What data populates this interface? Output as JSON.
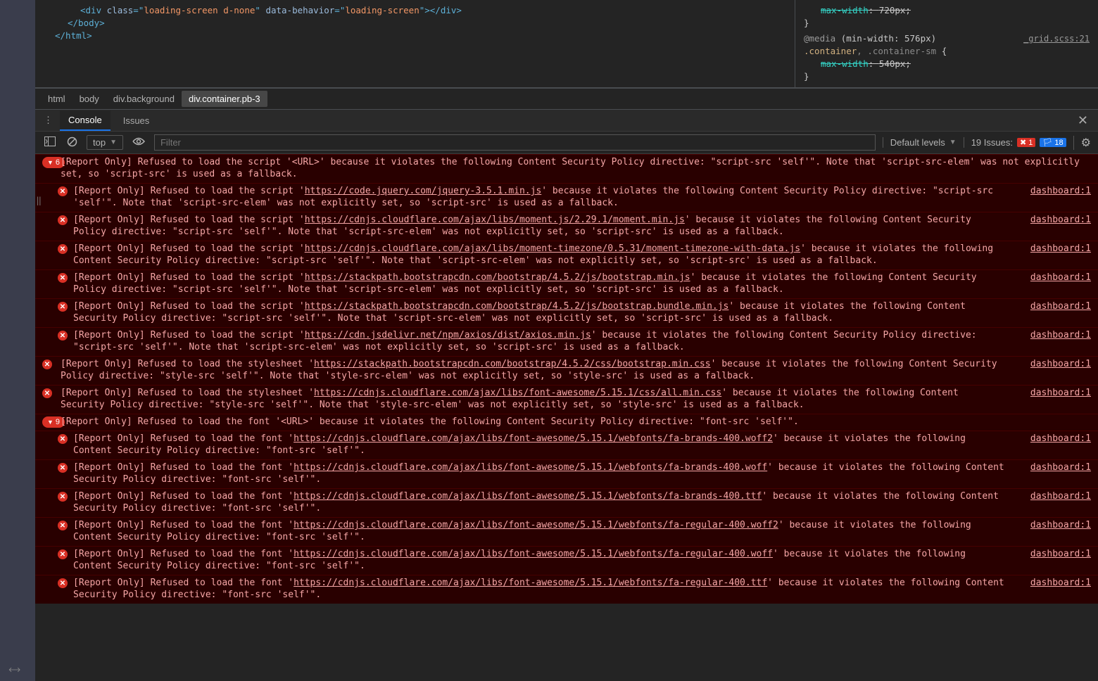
{
  "elements_html": {
    "line1_pre": "<div ",
    "line1_attr1": "class",
    "line1_val1": "loading-screen d-none",
    "line1_attr2": "data-behavior",
    "line1_val2": "loading-screen",
    "line1_post": "></div>",
    "line2": "</body>",
    "line3": "</html>"
  },
  "styles": {
    "rule0_prop": "max-width",
    "rule0_val": "720px;",
    "close0": "}",
    "at": "@media",
    "atcond": "(min-width: 576px)",
    "sel1a": ".container",
    "sel1b": ", .container-sm",
    "brace": "{",
    "prop1": "max-width",
    "val1": "540px;",
    "close1": "}",
    "srclink": "_grid.scss:21"
  },
  "crumbs": {
    "c1": "html",
    "c2": "body",
    "c3": "div.background",
    "c4": "div.container.pb-3"
  },
  "drawer": {
    "tab_console": "Console",
    "tab_issues": "Issues"
  },
  "toolbar": {
    "context": "top",
    "filter_placeholder": "Filter",
    "levels": "Default levels",
    "issues_label": "19 Issues:",
    "issues_red": "1",
    "issues_blue": "18"
  },
  "console": {
    "group1_count": "6",
    "group2_count": "9",
    "msgs": [
      {
        "lvl": 0,
        "group": "6",
        "pre": "[Report Only] Refused to load the script '<URL>' because it violates the following Content Security Policy directive: \"script-src 'self'\". Note that 'script-src-elem' was not explicitly set, so 'script-src' is used as a fallback.",
        "url": "",
        "post": "",
        "src": ""
      },
      {
        "lvl": 1,
        "err": true,
        "pre": "[Report Only] Refused to load the script '",
        "url": "https://code.jquery.com/jquery-3.5.1.min.js",
        "post": "' because it violates the following Content Security Policy directive: \"script-src 'self'\". Note that 'script-src-elem' was not explicitly set, so 'script-src' is used as a fallback.",
        "src": "dashboard:1"
      },
      {
        "lvl": 1,
        "err": true,
        "pre": "[Report Only] Refused to load the script '",
        "url": "https://cdnjs.cloudflare.com/ajax/libs/moment.js/2.29.1/moment.min.js",
        "post": "' because it violates the following Content Security Policy directive: \"script-src 'self'\". Note that 'script-src-elem' was not explicitly set, so 'script-src' is used as a fallback.",
        "src": "dashboard:1"
      },
      {
        "lvl": 1,
        "err": true,
        "pre": "[Report Only] Refused to load the script '",
        "url": "https://cdnjs.cloudflare.com/ajax/libs/moment-timezone/0.5.31/moment-timezone-with-data.js",
        "post": "' because it violates the following Content Security Policy directive: \"script-src 'self'\". Note that 'script-src-elem' was not explicitly set, so 'script-src' is used as a fallback.",
        "src": "dashboard:1"
      },
      {
        "lvl": 1,
        "err": true,
        "pre": "[Report Only] Refused to load the script '",
        "url": "https://stackpath.bootstrapcdn.com/bootstrap/4.5.2/js/bootstrap.min.js",
        "post": "' because it violates the following Content Security Policy directive: \"script-src 'self'\". Note that 'script-src-elem' was not explicitly set, so 'script-src' is used as a fallback.",
        "src": "dashboard:1"
      },
      {
        "lvl": 1,
        "err": true,
        "pre": "[Report Only] Refused to load the script '",
        "url": "https://stackpath.bootstrapcdn.com/bootstrap/4.5.2/js/bootstrap.bundle.min.js",
        "post": "' because it violates the following Content Security Policy directive: \"script-src 'self'\". Note that 'script-src-elem' was not explicitly set, so 'script-src' is used as a fallback.",
        "src": "dashboard:1"
      },
      {
        "lvl": 1,
        "err": true,
        "pre": "[Report Only] Refused to load the script '",
        "url": "https://cdn.jsdelivr.net/npm/axios/dist/axios.min.js",
        "post": "' because it violates the following Content Security Policy directive: \"script-src 'self'\". Note that 'script-src-elem' was not explicitly set, so 'script-src' is used as a fallback.",
        "src": "dashboard:1"
      },
      {
        "lvl": 0,
        "err": true,
        "pre": "[Report Only] Refused to load the stylesheet '",
        "url": "https://stackpath.bootstrapcdn.com/bootstrap/4.5.2/css/bootstrap.min.css",
        "post": "' because it violates the following Content Security Policy directive: \"style-src 'self'\". Note that 'style-src-elem' was not explicitly set, so 'style-src' is used as a fallback.",
        "src": "dashboard:1"
      },
      {
        "lvl": 0,
        "err": true,
        "pre": "[Report Only] Refused to load the stylesheet '",
        "url": "https://cdnjs.cloudflare.com/ajax/libs/font-awesome/5.15.1/css/all.min.css",
        "post": "' because it violates the following Content Security Policy directive: \"style-src 'self'\". Note that 'style-src-elem' was not explicitly set, so 'style-src' is used as a fallback.",
        "src": "dashboard:1"
      },
      {
        "lvl": 0,
        "group": "9",
        "pre": "[Report Only] Refused to load the font '<URL>' because it violates the following Content Security Policy directive: \"font-src 'self'\".",
        "url": "",
        "post": "",
        "src": ""
      },
      {
        "lvl": 1,
        "err": true,
        "pre": "[Report Only] Refused to load the font '",
        "url": "https://cdnjs.cloudflare.com/ajax/libs/font-awesome/5.15.1/webfonts/fa-brands-400.woff2",
        "post": "' because it violates the following Content Security Policy directive: \"font-src 'self'\".",
        "src": "dashboard:1"
      },
      {
        "lvl": 1,
        "err": true,
        "pre": "[Report Only] Refused to load the font '",
        "url": "https://cdnjs.cloudflare.com/ajax/libs/font-awesome/5.15.1/webfonts/fa-brands-400.woff",
        "post": "' because it violates the following Content Security Policy directive: \"font-src 'self'\".",
        "src": "dashboard:1"
      },
      {
        "lvl": 1,
        "err": true,
        "pre": "[Report Only] Refused to load the font '",
        "url": "https://cdnjs.cloudflare.com/ajax/libs/font-awesome/5.15.1/webfonts/fa-brands-400.ttf",
        "post": "' because it violates the following Content Security Policy directive: \"font-src 'self'\".",
        "src": "dashboard:1"
      },
      {
        "lvl": 1,
        "err": true,
        "pre": "[Report Only] Refused to load the font '",
        "url": "https://cdnjs.cloudflare.com/ajax/libs/font-awesome/5.15.1/webfonts/fa-regular-400.woff2",
        "post": "' because it violates the following Content Security Policy directive: \"font-src 'self'\".",
        "src": "dashboard:1"
      },
      {
        "lvl": 1,
        "err": true,
        "pre": "[Report Only] Refused to load the font '",
        "url": "https://cdnjs.cloudflare.com/ajax/libs/font-awesome/5.15.1/webfonts/fa-regular-400.woff",
        "post": "' because it violates the following Content Security Policy directive: \"font-src 'self'\".",
        "src": "dashboard:1"
      },
      {
        "lvl": 1,
        "err": true,
        "pre": "[Report Only] Refused to load the font '",
        "url": "https://cdnjs.cloudflare.com/ajax/libs/font-awesome/5.15.1/webfonts/fa-regular-400.ttf",
        "post": "' because it violates the following Content Security Policy directive: \"font-src 'self'\".",
        "src": "dashboard:1"
      }
    ]
  }
}
